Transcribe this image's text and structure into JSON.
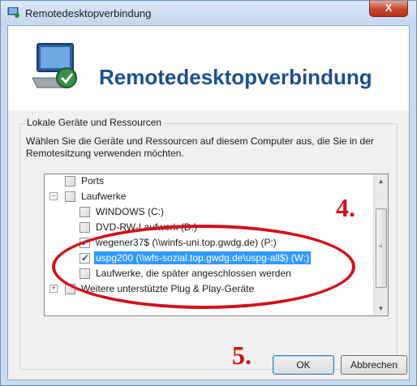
{
  "window": {
    "title": "Remotedesktopverbindung",
    "close_label": "X"
  },
  "banner": {
    "title": "Remotedesktopverbindung"
  },
  "group": {
    "label": "Lokale Geräte und Ressourcen",
    "description": "Wählen Sie die Geräte und Ressourcen auf diesem Computer aus, die Sie in der Remotesitzung verwenden möchten."
  },
  "tree": {
    "items": [
      {
        "label": "Ports",
        "checked": false
      },
      {
        "label": "Laufwerke",
        "checked": false,
        "expander": "−"
      },
      {
        "label": "WINDOWS (C:)",
        "checked": false
      },
      {
        "label": "DVD-RW-Laufwerk (D:)",
        "checked": false
      },
      {
        "label": "wegener37$ (\\\\winfs-uni.top.gwdg.de) (P:)",
        "checked": true
      },
      {
        "label": "uspg200 (\\\\wfs-sozial.top.gwdg.de\\uspg-all$) (W:)",
        "checked": true,
        "selected": true
      },
      {
        "label": "Laufwerke, die später angeschlossen werden",
        "checked": false
      },
      {
        "label": "Weitere unterstützte Plug & Play-Geräte",
        "checked": false,
        "expander": "+"
      }
    ]
  },
  "buttons": {
    "ok": "OK",
    "cancel": "Abbrechen"
  },
  "annotations": {
    "step4": "4.",
    "step5": "5."
  },
  "colors": {
    "accent": "#1d4f91",
    "selection": "#3399ff",
    "annotation": "#d1121c"
  }
}
